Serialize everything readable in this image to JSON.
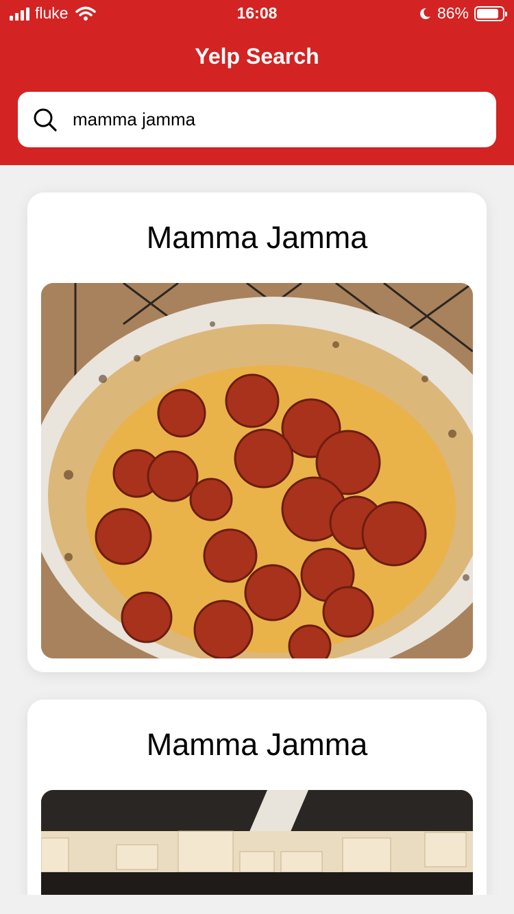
{
  "status": {
    "carrier": "fluke",
    "time": "16:08",
    "battery": "86%",
    "battery_level": 0.86
  },
  "header": {
    "title": "Yelp Search"
  },
  "search": {
    "value": "mamma jamma",
    "icon": "search-icon"
  },
  "results": [
    {
      "name": "Mamma Jamma",
      "photo": "pepperoni-pizza-photo"
    },
    {
      "name": "Mamma Jamma",
      "photo": "restaurant-interior-photo"
    }
  ],
  "colors": {
    "brand": "#d32323",
    "background": "#f0f0f0"
  }
}
